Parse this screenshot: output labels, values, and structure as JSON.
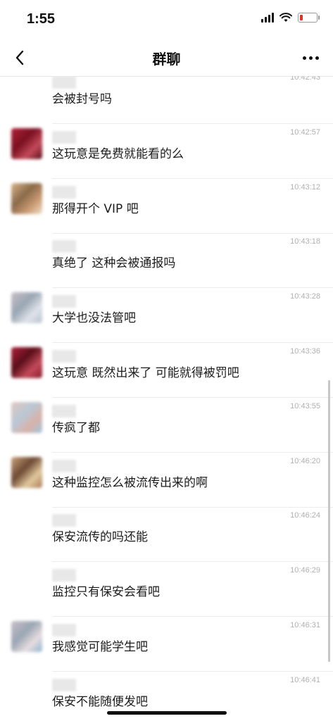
{
  "status": {
    "time": "1:55"
  },
  "nav": {
    "title": "群聊"
  },
  "messages": [
    {
      "time": "10:42:43",
      "text": "会被封号吗",
      "avatar": null
    },
    {
      "time": "10:42:57",
      "text": "这玩意是免费就能看的么",
      "avatar": {
        "colors": [
          "#b0223a",
          "#7a1020",
          "#c44a5a",
          "#5a0e1a"
        ]
      }
    },
    {
      "time": "10:43:12",
      "text": "那得开个 VIP 吧",
      "avatar": {
        "colors": [
          "#d9b58a",
          "#8a6a4a",
          "#c99a72",
          "#f1e0c8"
        ]
      }
    },
    {
      "time": "10:43:18",
      "text": "真绝了 这种会被通报吗",
      "avatar": null
    },
    {
      "time": "10:43:28",
      "text": "大学也没法管吧",
      "avatar": {
        "colors": [
          "#c8c0c8",
          "#9aa6b4",
          "#dfe3ea",
          "#b7c2cf"
        ]
      }
    },
    {
      "time": "10:43:36",
      "text": "这玩意 既然出来了 可能就得被罚吧",
      "avatar": {
        "colors": [
          "#b0223a",
          "#5a0e1a",
          "#c44a5a",
          "#8a1a2a"
        ]
      }
    },
    {
      "time": "10:43:55",
      "text": "传疯了都",
      "avatar": {
        "colors": [
          "#e2c8bd",
          "#b9c8d6",
          "#d8b2a8",
          "#9fc6e0"
        ]
      }
    },
    {
      "time": "10:46:20",
      "text": "这种监控怎么被流传出来的啊",
      "avatar": {
        "colors": [
          "#c9a27a",
          "#6e4a34",
          "#e2c89e",
          "#a67c58"
        ]
      }
    },
    {
      "time": "10:46:24",
      "text": "保安流传的吗还能",
      "avatar": null
    },
    {
      "time": "10:46:29",
      "text": "监控只有保安会看吧",
      "avatar": null
    },
    {
      "time": "10:46:31",
      "text": "我感觉可能学生吧",
      "avatar": {
        "colors": [
          "#c8c0c8",
          "#9aa6b4",
          "#e6dde0",
          "#8fb4cf"
        ]
      }
    },
    {
      "time": "10:46:41",
      "text": "保安不能随便发吧",
      "avatar": null
    }
  ],
  "colors": {
    "accent_text": "#1c1c1c",
    "timestamp": "#b0b0b0",
    "divider": "#ececec"
  }
}
